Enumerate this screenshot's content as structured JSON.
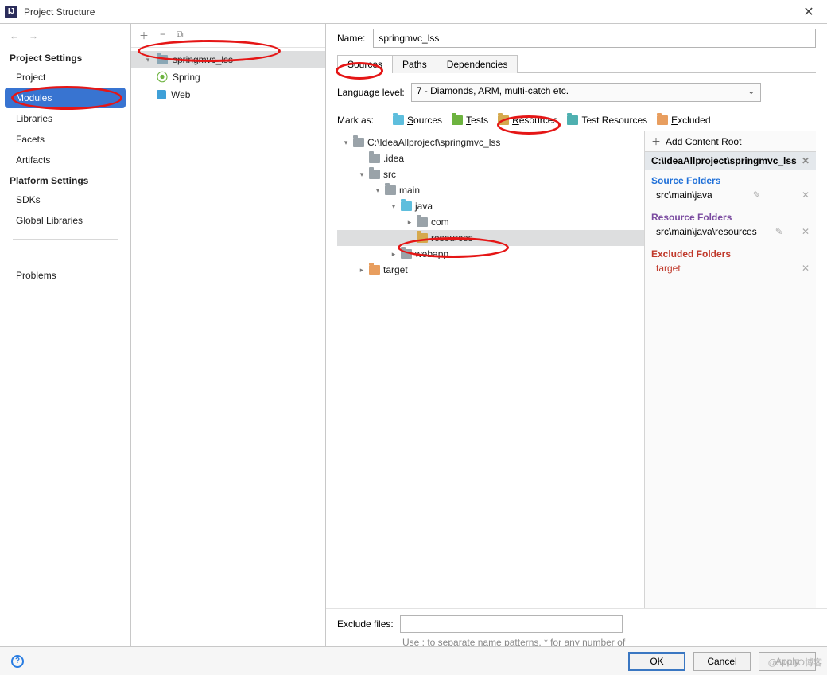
{
  "window": {
    "title": "Project Structure"
  },
  "sidebar": {
    "sections": [
      {
        "heading": "Project Settings",
        "items": [
          "Project",
          "Modules",
          "Libraries",
          "Facets",
          "Artifacts"
        ],
        "selected": 1
      },
      {
        "heading": "Platform Settings",
        "items": [
          "SDKs",
          "Global Libraries"
        ]
      }
    ],
    "problems": "Problems"
  },
  "modules_tree": {
    "root": "springmvc_lss",
    "children": [
      "Spring",
      "Web"
    ]
  },
  "name": {
    "label": "Name:",
    "value": "springmvc_lss"
  },
  "tabs": [
    "Sources",
    "Paths",
    "Dependencies"
  ],
  "language": {
    "label": "Language level:",
    "value": "7 - Diamonds, ARM, multi-catch etc."
  },
  "mark": {
    "label": "Mark as:",
    "options": [
      "Sources",
      "Tests",
      "Resources",
      "Test Resources",
      "Excluded"
    ]
  },
  "file_tree": {
    "root": "C:\\IdeaAllproject\\springmvc_lss",
    "items": [
      {
        "pad": 1,
        "label": ".idea",
        "icon": "grey",
        "arrow": ""
      },
      {
        "pad": 1,
        "label": "src",
        "icon": "grey",
        "arrow": "v"
      },
      {
        "pad": 2,
        "label": "main",
        "icon": "grey",
        "arrow": "v"
      },
      {
        "pad": 3,
        "label": "java",
        "icon": "blue",
        "arrow": "v"
      },
      {
        "pad": 4,
        "label": "com",
        "icon": "grey",
        "arrow": ">"
      },
      {
        "pad": 4,
        "label": "resources",
        "icon": "gold",
        "arrow": "",
        "selected": true
      },
      {
        "pad": 3,
        "label": "webapp",
        "icon": "grey",
        "arrow": ">"
      },
      {
        "pad": 1,
        "label": "target",
        "icon": "orange",
        "arrow": ">"
      }
    ]
  },
  "roots": {
    "add": "Add Content Root",
    "path": "C:\\IdeaAllproject\\springmvc_lss",
    "source": {
      "title": "Source Folders",
      "entry": "src\\main\\java"
    },
    "resource": {
      "title": "Resource Folders",
      "entry": "src\\main\\java\\resources"
    },
    "excluded": {
      "title": "Excluded Folders",
      "entry": "target"
    }
  },
  "exclude": {
    "label": "Exclude files:",
    "hint": "Use ; to separate name patterns, * for any number of symbols, ? for one."
  },
  "footer": {
    "ok": "OK",
    "cancel": "Cancel",
    "apply": "Apply"
  },
  "watermark": "@51CTO博客"
}
